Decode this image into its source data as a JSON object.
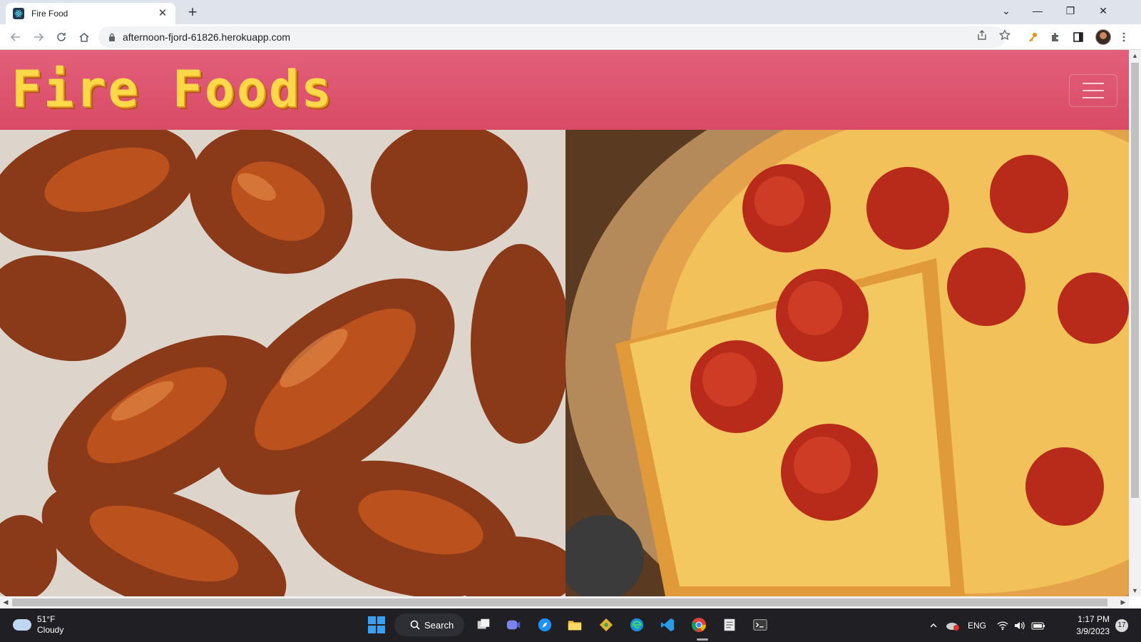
{
  "browser": {
    "tab_title": "Fire Food",
    "url": "afternoon-fjord-61826.herokuapp.com",
    "tab_close_icon": "close-icon",
    "new_tab_icon": "plus-icon"
  },
  "site": {
    "brand": "Fire Foods",
    "nav_color": "#e0586f",
    "brand_color": "#ffd84a",
    "hero_images": [
      "chicken wings",
      "pepperoni pizza"
    ]
  },
  "taskbar": {
    "temperature": "51°F",
    "condition": "Cloudy",
    "search_label": "Search",
    "language": "ENG",
    "time": "1:17 PM",
    "date": "3/9/2023",
    "notification_count": "17"
  }
}
